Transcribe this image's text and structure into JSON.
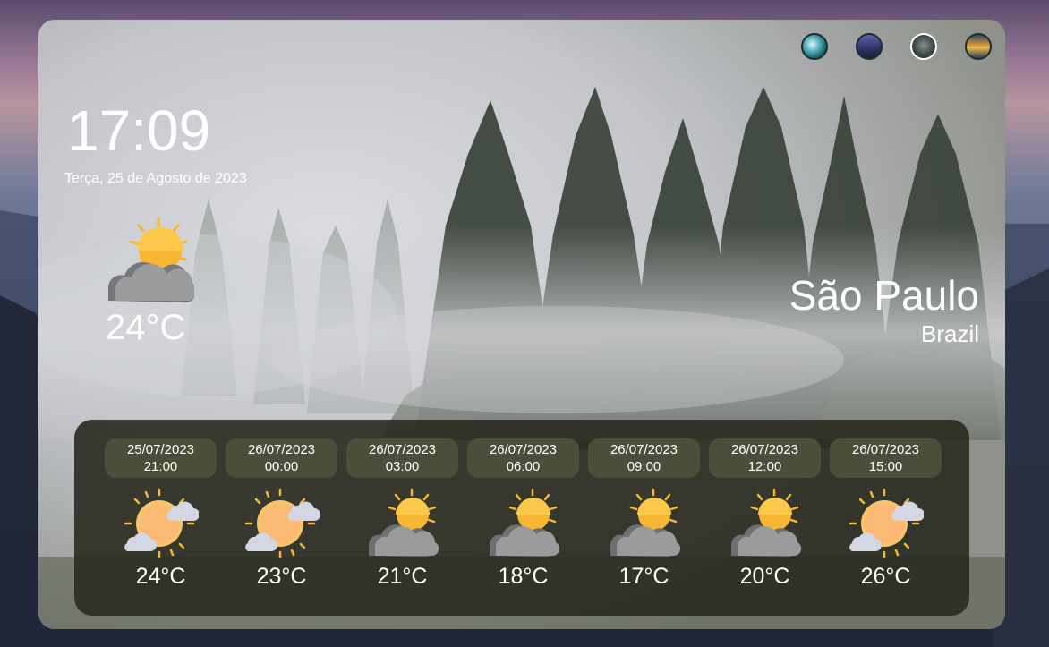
{
  "clock": {
    "time": "17:09",
    "date": "Terça, 25 de Agosto de 2023"
  },
  "theme_switcher": {
    "themes": [
      {
        "name": "ocean-wave-theme"
      },
      {
        "name": "night-mountain-theme"
      },
      {
        "name": "foggy-forest-theme",
        "selected": true
      },
      {
        "name": "sunset-lake-theme"
      }
    ]
  },
  "current": {
    "icon": "partly-cloudy-icon",
    "temp": "24°C"
  },
  "location": {
    "city": "São Paulo",
    "country": "Brazil"
  },
  "forecast": [
    {
      "date": "25/07/2023",
      "time": "21:00",
      "icon": "sun-clouds-icon",
      "temp": "24°C"
    },
    {
      "date": "26/07/2023",
      "time": "00:00",
      "icon": "sun-clouds-icon",
      "temp": "23°C"
    },
    {
      "date": "26/07/2023",
      "time": "03:00",
      "icon": "partly-cloudy-icon",
      "temp": "21°C"
    },
    {
      "date": "26/07/2023",
      "time": "06:00",
      "icon": "partly-cloudy-icon",
      "temp": "18°C"
    },
    {
      "date": "26/07/2023",
      "time": "09:00",
      "icon": "partly-cloudy-icon",
      "temp": "17°C"
    },
    {
      "date": "26/07/2023",
      "time": "12:00",
      "icon": "partly-cloudy-icon",
      "temp": "20°C"
    },
    {
      "date": "26/07/2023",
      "time": "15:00",
      "icon": "sun-clouds-icon",
      "temp": "26°C"
    }
  ],
  "colors": {
    "forecast_panel": "#2b2c22",
    "forecast_chip": "#4c4e39",
    "text": "#ffffff",
    "sun": "#f7b733"
  }
}
